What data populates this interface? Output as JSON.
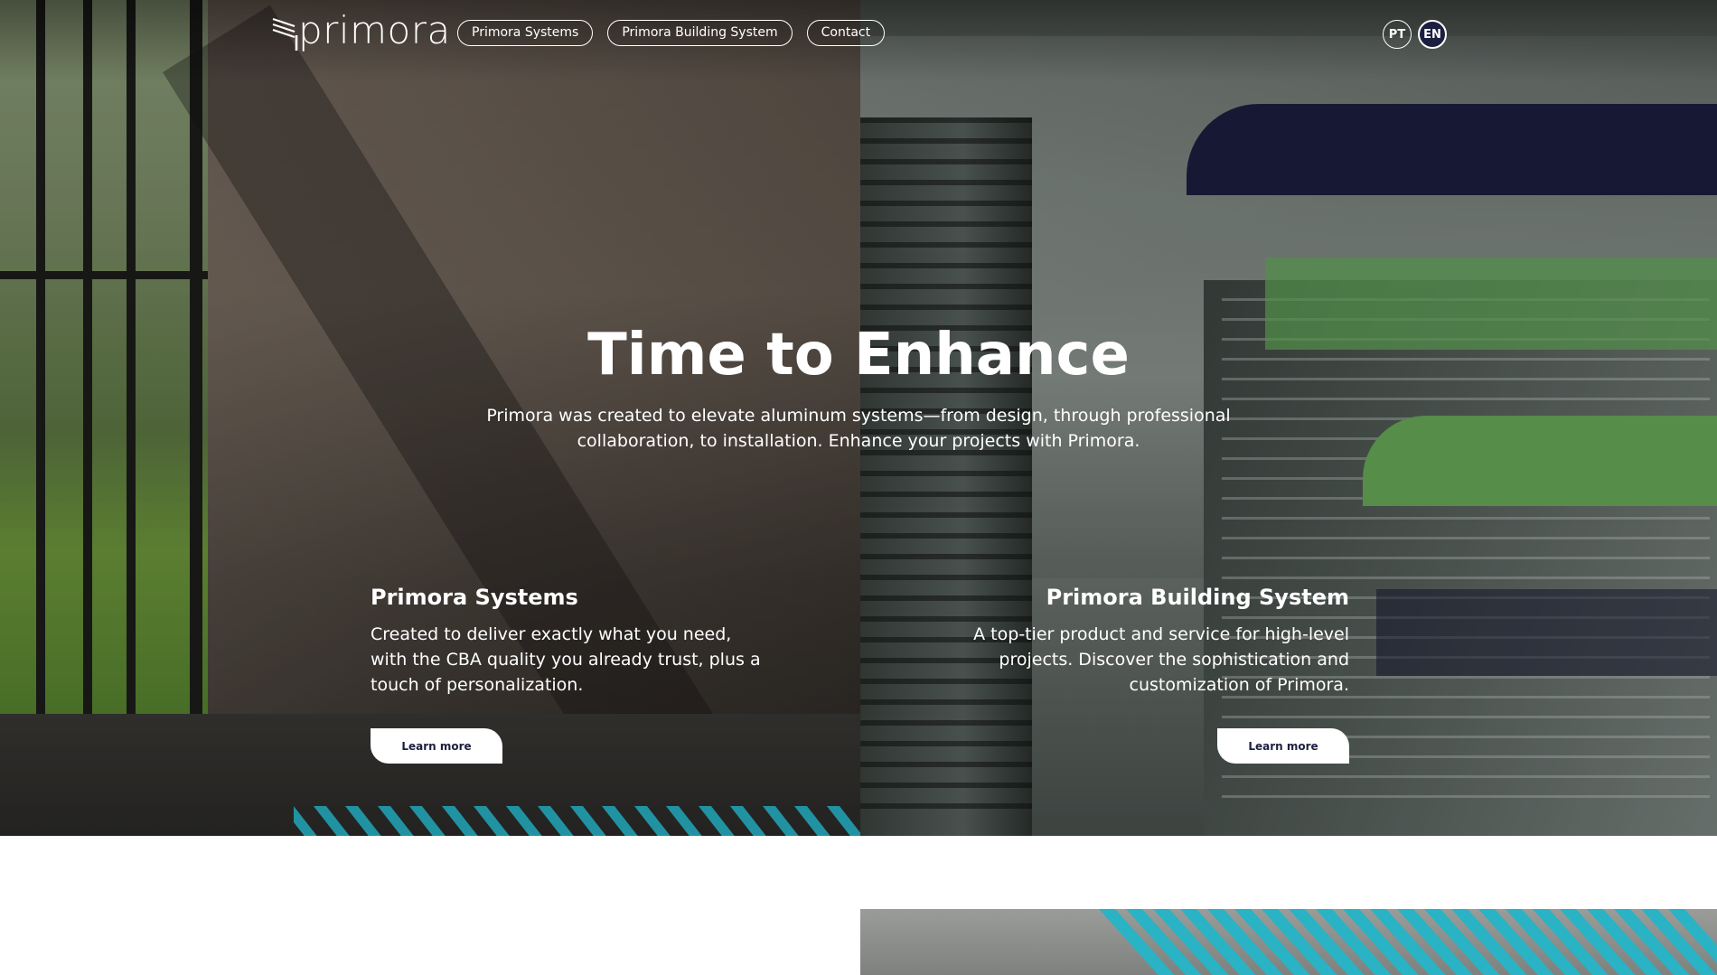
{
  "header": {
    "logo_text": "primora",
    "nav": [
      {
        "label": "Primora Systems"
      },
      {
        "label": "Primora Building System"
      },
      {
        "label": "Contact"
      }
    ],
    "languages": [
      {
        "label": "PT",
        "active": false
      },
      {
        "label": "EN",
        "active": true
      }
    ]
  },
  "hero": {
    "title": "Time to Enhance",
    "subtitle": "Primora was created to elevate aluminum systems—from design, through professional collaboration, to installation. Enhance your projects with Primora."
  },
  "cards": [
    {
      "title": "Primora Systems",
      "description": "Created to deliver exactly what you need, with the CBA quality you already trust, plus a touch of personalization.",
      "button": "Learn more"
    },
    {
      "title": "Primora Building System",
      "description": "A top-tier product and service for high-level projects. Discover the sophistication and customization of Primora.",
      "button": "Learn more"
    }
  ],
  "colors": {
    "navy": "#1d1f40",
    "green": "#6aac58",
    "teal": "#29b3c5",
    "white": "#ffffff"
  },
  "icons": {
    "logo_mark": "stacked-lines-logo-icon"
  }
}
